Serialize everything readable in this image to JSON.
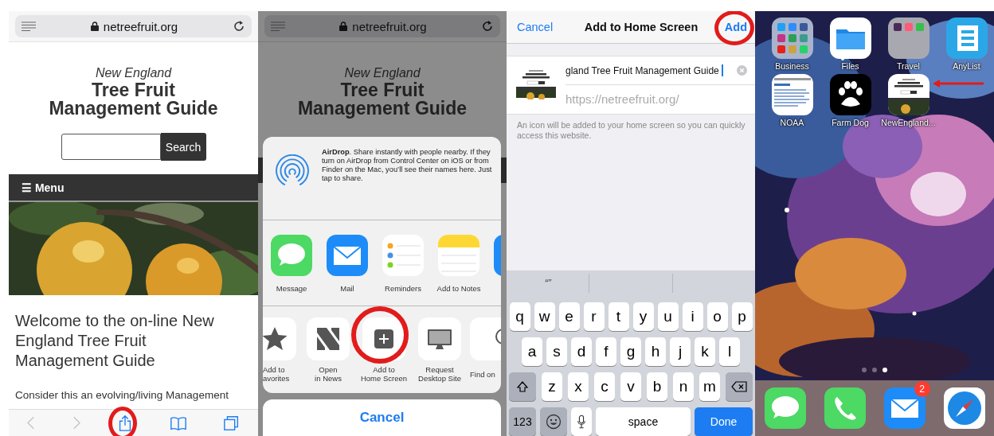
{
  "browser": {
    "url": "netreefruit.org",
    "site_subtitle": "New England",
    "site_title": [
      "Tree Fruit",
      "Management Guide"
    ],
    "search_button": "Search",
    "menu_label": "☰ Menu",
    "heading": "Welcome to the on-line New England Tree Fruit Management Guide",
    "intro": "Consider this an evolving/living Management",
    "toolbar": [
      {
        "kind": "back",
        "disabled": true,
        "highlighted": false
      },
      {
        "kind": "forward",
        "disabled": true,
        "highlighted": false
      },
      {
        "kind": "share",
        "disabled": false,
        "highlighted": true
      },
      {
        "kind": "bookmarks",
        "disabled": false,
        "highlighted": false
      },
      {
        "kind": "tabs",
        "disabled": false,
        "highlighted": false
      }
    ]
  },
  "share_sheet": {
    "url": "netreefruit.org",
    "site_subtitle": "New England",
    "site_title": [
      "Tree Fruit",
      "Management Guide"
    ],
    "airdrop_text": "**AirDrop**. Share instantly with people nearby. If they turn on AirDrop from Control Center on iOS or from Finder on the Mac, you’ll see their names here. Just tap to share.",
    "apps": [
      {
        "kind": "messages",
        "label": "Message"
      },
      {
        "kind": "mail",
        "label": "Mail"
      },
      {
        "kind": "reminders",
        "label": "Reminders"
      },
      {
        "kind": "notes",
        "label": "Add to Notes"
      },
      {
        "kind": "blue"
      }
    ],
    "actions": [
      {
        "kind": "favorites",
        "lines": [
          "Add to",
          "avorites"
        ],
        "highlighted": false
      },
      {
        "kind": "news",
        "lines": [
          "Open",
          "in News"
        ],
        "highlighted": false
      },
      {
        "kind": "add-home",
        "lines": [
          "Add to",
          "Home Screen"
        ],
        "highlighted": true
      },
      {
        "kind": "desktop",
        "lines": [
          "Request",
          "Desktop Site"
        ],
        "highlighted": false
      },
      {
        "kind": "find",
        "lines": [
          "Find on"
        ],
        "highlighted": false
      }
    ],
    "cancel": "Cancel"
  },
  "add_screen": {
    "cancel": "Cancel",
    "title": "Add to Home Screen",
    "add": "Add",
    "add_highlighted": true,
    "name_value": "gland Tree Fruit Management Guide",
    "url": "https://netreefruit.org/",
    "note": "An icon will be added to your home screen so you can quickly access this website.",
    "suggestions": [
      "“”"
    ],
    "key_rows": [
      [
        "q",
        "w",
        "e",
        "r",
        "t",
        "y",
        "u",
        "i",
        "o",
        "p"
      ],
      [
        "a",
        "s",
        "d",
        "f",
        "g",
        "h",
        "j",
        "k",
        "l"
      ],
      [
        "z",
        "x",
        "c",
        "v",
        "b",
        "n",
        "m"
      ]
    ],
    "bottom_keys": [
      {
        "kind": "numbers",
        "label": "123"
      },
      {
        "kind": "emoji"
      },
      {
        "kind": "mic"
      },
      {
        "kind": "space",
        "label": "space"
      },
      {
        "kind": "done",
        "label": "Done"
      }
    ]
  },
  "home_screen": {
    "apps": [
      {
        "kind": "folder-business",
        "label": "Business",
        "highlighted": false
      },
      {
        "kind": "files",
        "label": "Files",
        "highlighted": false
      },
      {
        "kind": "folder-travel",
        "label": "Travel",
        "highlighted": false
      },
      {
        "kind": "anylist",
        "label": "AnyList",
        "highlighted": false
      },
      {
        "kind": "noaa",
        "label": "NOAA",
        "highlighted": false
      },
      {
        "kind": "farmdog",
        "label": "Farm Dog",
        "highlighted": false
      },
      {
        "kind": "webclip",
        "label": "NewEngland...",
        "highlighted": true
      }
    ],
    "pages": [
      {
        "selected": false
      },
      {
        "selected": false
      },
      {
        "selected": true
      }
    ],
    "dock": [
      {
        "kind": "messages"
      },
      {
        "kind": "phone"
      },
      {
        "kind": "mail",
        "badge": "2"
      },
      {
        "kind": "safari"
      }
    ]
  }
}
